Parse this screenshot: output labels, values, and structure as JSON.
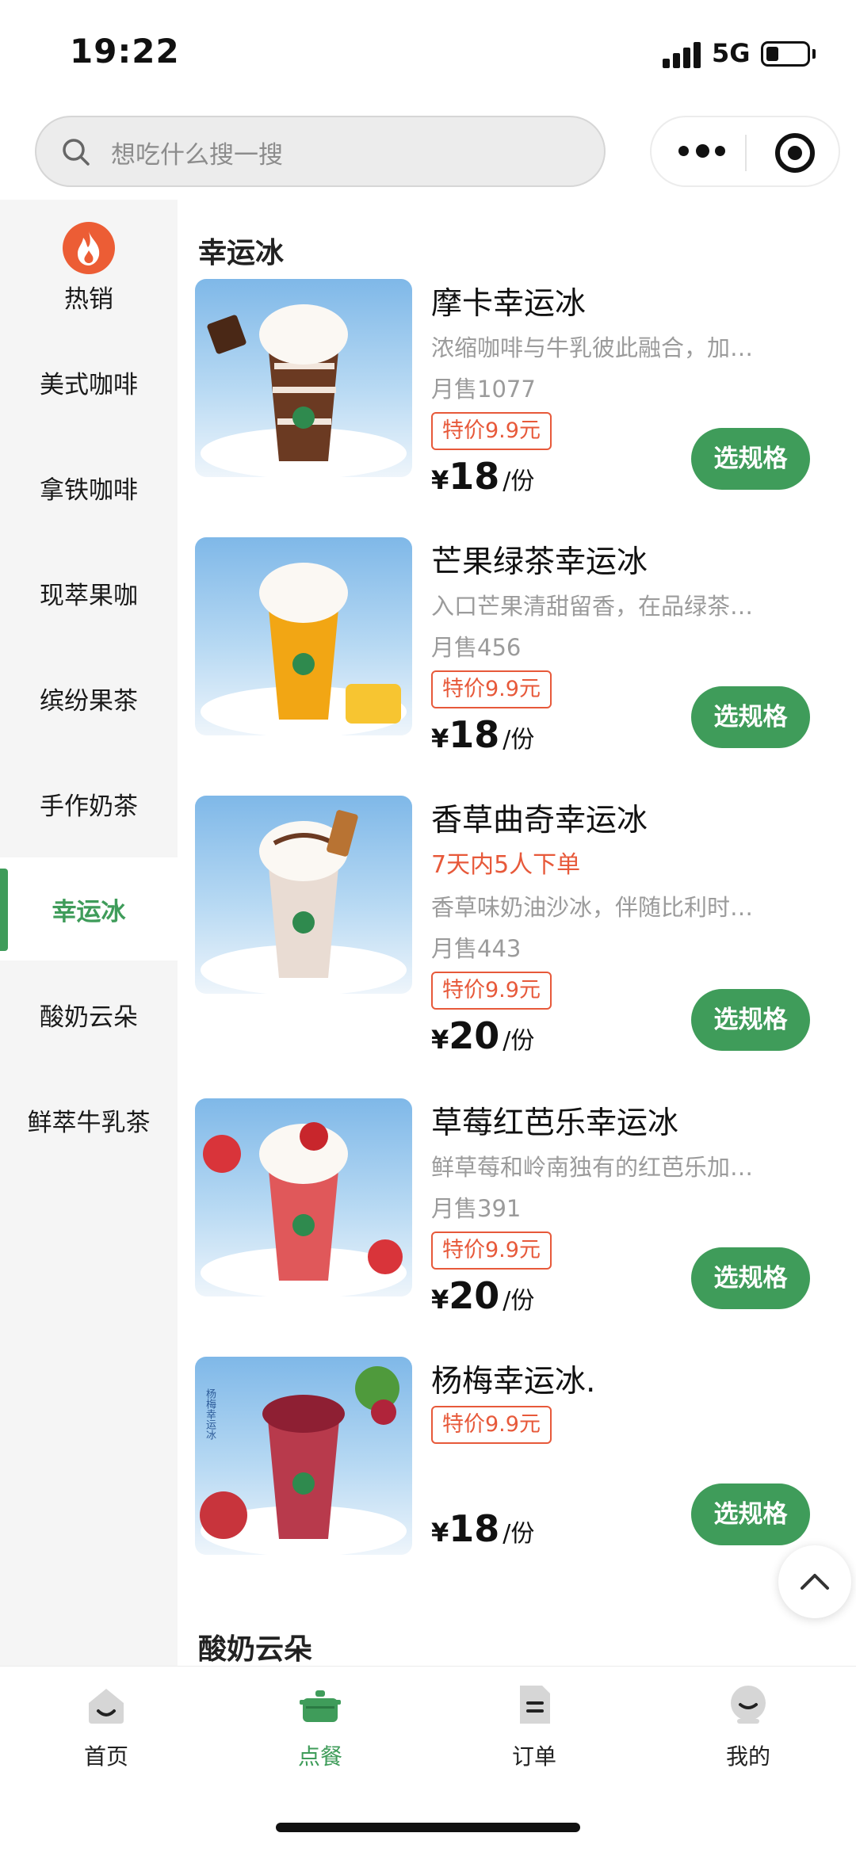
{
  "status_bar": {
    "time": "19:22",
    "network": "5G",
    "battery_level": 0.3
  },
  "search": {
    "placeholder": "想吃什么搜一搜"
  },
  "sidebar": {
    "items": [
      {
        "label": "热销",
        "icon": "flame-icon"
      },
      {
        "label": "美式咖啡"
      },
      {
        "label": "拿铁咖啡"
      },
      {
        "label": "现萃果咖"
      },
      {
        "label": "缤纷果茶"
      },
      {
        "label": "手作奶茶"
      },
      {
        "label": "幸运冰",
        "active": true
      },
      {
        "label": "酸奶云朵"
      },
      {
        "label": "鲜萃牛乳茶"
      }
    ]
  },
  "content": {
    "section_title": "幸运冰",
    "next_section_title": "酸奶云朵",
    "products": [
      {
        "name": "摩卡幸运冰",
        "desc": "浓缩咖啡与牛乳彼此融合，加…",
        "sales": "月售1077",
        "badge": "特价9.9元",
        "price_symbol": "¥",
        "price": "18",
        "unit": "/份",
        "button": "选规格",
        "image": "mocha-drink-image"
      },
      {
        "name": "芒果绿茶幸运冰",
        "desc": "入口芒果清甜留香，在品绿茶…",
        "sales": "月售456",
        "badge": "特价9.9元",
        "price_symbol": "¥",
        "price": "18",
        "unit": "/份",
        "button": "选规格",
        "image": "mango-drink-image"
      },
      {
        "name": "香草曲奇幸运冰",
        "hot": "7天内5人下单",
        "desc": "香草味奶油沙冰，伴随比利时…",
        "sales": "月售443",
        "badge": "特价9.9元",
        "price_symbol": "¥",
        "price": "20",
        "unit": "/份",
        "button": "选规格",
        "image": "vanilla-drink-image"
      },
      {
        "name": "草莓红芭乐幸运冰",
        "desc": "鲜草莓和岭南独有的红芭乐加…",
        "sales": "月售391",
        "badge": "特价9.9元",
        "price_symbol": "¥",
        "price": "20",
        "unit": "/份",
        "button": "选规格",
        "image": "strawberry-drink-image"
      },
      {
        "name": "杨梅幸运冰.",
        "badge": "特价9.9元",
        "price_symbol": "¥",
        "price": "18",
        "unit": "/份",
        "button": "选规格",
        "image": "bayberry-drink-image",
        "image_text": "杨梅幸运冰"
      }
    ]
  },
  "tab_bar": {
    "tabs": [
      {
        "label": "首页",
        "icon": "home-icon"
      },
      {
        "label": "点餐",
        "icon": "pot-icon",
        "active": true
      },
      {
        "label": "订单",
        "icon": "order-icon"
      },
      {
        "label": "我的",
        "icon": "profile-icon"
      }
    ]
  },
  "colors": {
    "brand_green": "#3f9c5a",
    "promo_red": "#e7593a",
    "hot_orange": "#ec5d35"
  }
}
